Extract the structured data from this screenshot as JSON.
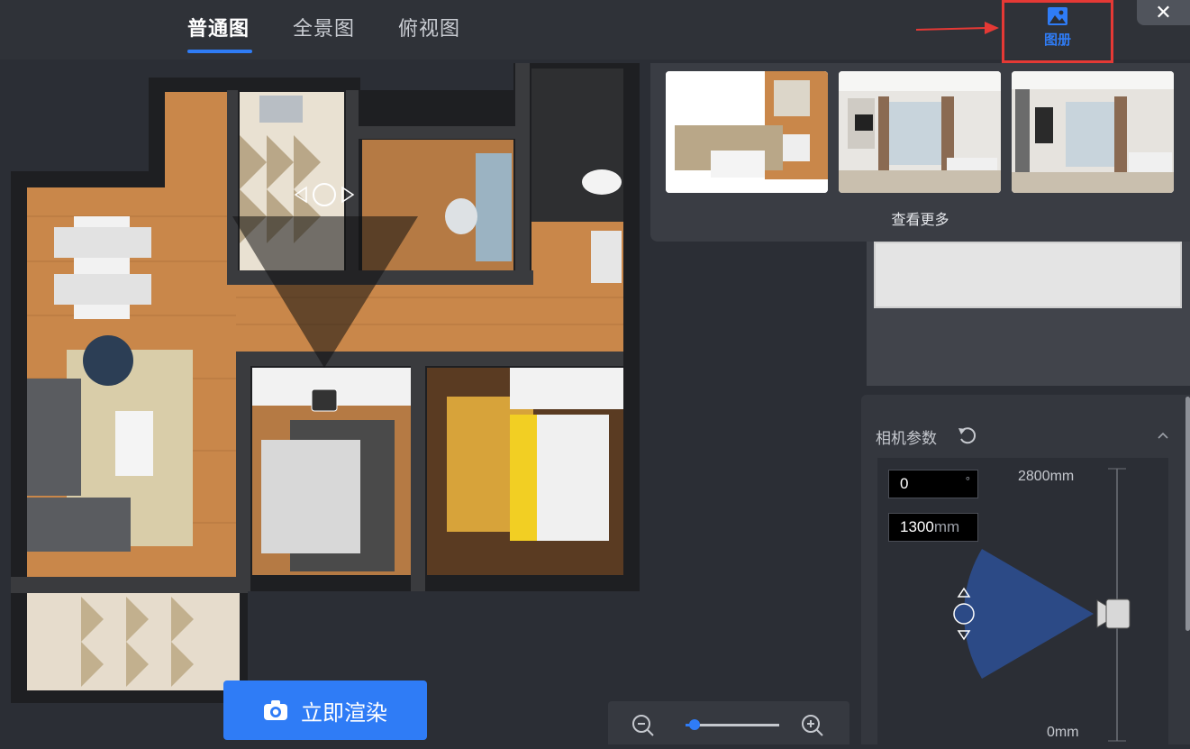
{
  "tabs": [
    {
      "label": "普通图",
      "active": true
    },
    {
      "label": "全景图",
      "active": false
    },
    {
      "label": "俯视图",
      "active": false
    }
  ],
  "album": {
    "label": "图册",
    "icon": "image-icon"
  },
  "close": {
    "label": "✕"
  },
  "gallery": {
    "more_label": "查看更多"
  },
  "camera": {
    "title": "相机参数",
    "angle_value": "0",
    "angle_unit": "°",
    "height_value": "1300",
    "height_unit": "mm",
    "scale_top": "2800mm",
    "scale_bottom": "0mm"
  },
  "render_button": {
    "label": "立即渲染",
    "icon": "camera-icon"
  },
  "zoom": {
    "out_icon": "zoom-out-icon",
    "in_icon": "zoom-in-icon",
    "level": 0.1
  },
  "colors": {
    "accent": "#2f7cf6",
    "highlight": "#e53935",
    "bg": "#2b2e35"
  }
}
